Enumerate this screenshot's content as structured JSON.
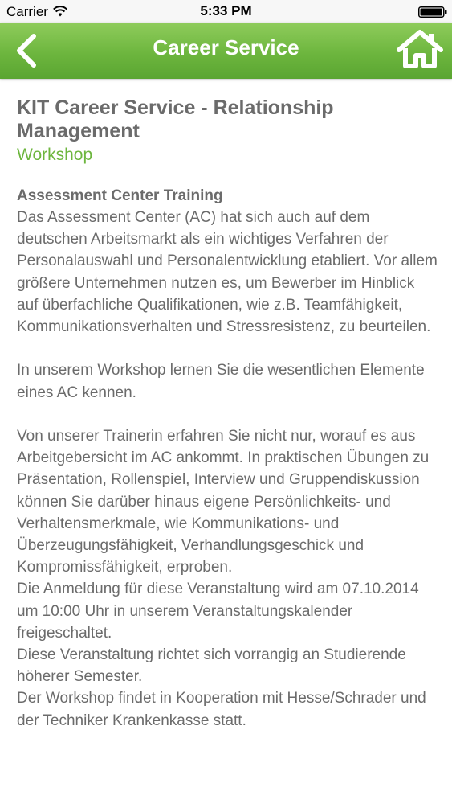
{
  "status_bar": {
    "carrier": "Carrier",
    "time": "5:33 PM"
  },
  "nav": {
    "title": "Career Service",
    "back_icon": "chevron-left-icon",
    "home_icon": "home-icon",
    "color": "#6db63e"
  },
  "content": {
    "title": "KIT Career Service - Relationship Management",
    "category": "Workshop",
    "event_title": "Assessment Center Training",
    "paragraphs": [
      "Das Assessment Center (AC) hat sich auch auf dem deutschen Arbeitsmarkt als ein wichtiges Verfahren der Personalauswahl und Personalentwicklung etabliert. Vor allem größere Unternehmen nutzen es, um Bewerber im Hinblick auf überfachliche Qualifikationen, wie z.B. Teamfähigkeit, Kommunikationsverhalten und Stressresistenz, zu beurteilen.",
      "In unserem Workshop lernen Sie die wesentlichen Elemente eines AC kennen.",
      "Von unserer Trainerin erfahren Sie nicht nur, worauf es aus Arbeitgebersicht im AC ankommt. In praktischen Übungen zu Präsentation, Rollenspiel, Interview und Gruppendiskussion können Sie darüber hinaus eigene Persönlichkeits- und Verhaltensmerkmale, wie Kommunikations- und Überzeugungsfähigkeit, Verhandlungsgeschick und Kompromissfähigkeit, erproben.",
      "Die Anmeldung für diese Veranstaltung wird am 07.10.2014 um 10:00 Uhr in unserem Veranstaltungskalender freigeschaltet.",
      "Diese Veranstaltung richtet sich vorrangig an Studierende höherer Semester.",
      "Der Workshop findet in Kooperation mit Hesse/Schrader und der Techniker Krankenkasse statt."
    ]
  }
}
